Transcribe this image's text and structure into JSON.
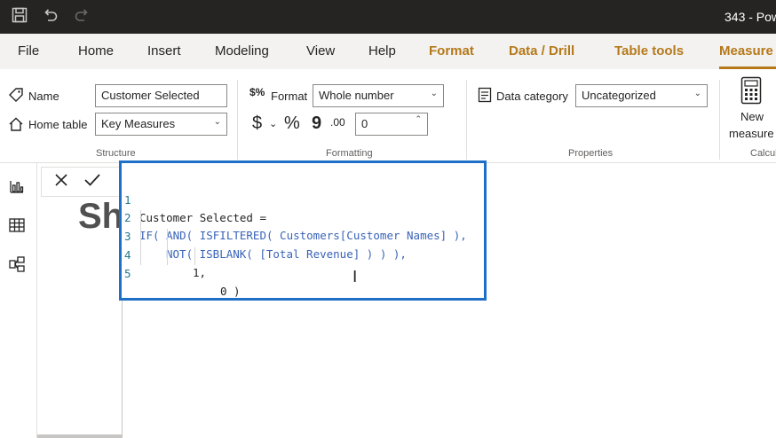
{
  "window": {
    "title": "343 - Pow"
  },
  "tabs": [
    {
      "label": "File"
    },
    {
      "label": "Home"
    },
    {
      "label": "Insert"
    },
    {
      "label": "Modeling"
    },
    {
      "label": "View"
    },
    {
      "label": "Help"
    },
    {
      "label": "Format"
    },
    {
      "label": "Data / Drill"
    },
    {
      "label": "Table tools"
    },
    {
      "label": "Measure"
    }
  ],
  "ribbon": {
    "structure": {
      "name_label": "Name",
      "name_value": "Customer Selected",
      "home_table_label": "Home table",
      "home_table_value": "Key Measures",
      "group_label": "Structure"
    },
    "formatting": {
      "format_label": "Format",
      "format_value": "Whole number",
      "currency_symbol": "$",
      "percent_symbol": "%",
      "comma_symbol": "9",
      "decimals_icon": ".00",
      "decimals_value": "0",
      "group_label": "Formatting"
    },
    "properties": {
      "data_category_label": "Data category",
      "data_category_value": "Uncategorized",
      "group_label": "Properties"
    },
    "calculations": {
      "new_measure_label_1": "New",
      "new_measure_label_2": "measure",
      "group_label": "Calcul"
    }
  },
  "canvas": {
    "background_title": "Sh"
  },
  "editor": {
    "lines": [
      {
        "num": "1",
        "text": "Customer Selected ="
      },
      {
        "num": "2",
        "text": "IF( AND( ISFILTERED( Customers[Customer Names] ),"
      },
      {
        "num": "3",
        "text": "NOT( ISBLANK( [Total Revenue] ) ) ),"
      },
      {
        "num": "4",
        "text": "1,"
      },
      {
        "num": "5",
        "text": "0 )"
      }
    ]
  },
  "colors": {
    "accent": "#b5791a",
    "editor_border": "#1f6fc7",
    "titlebar": "#252423"
  }
}
